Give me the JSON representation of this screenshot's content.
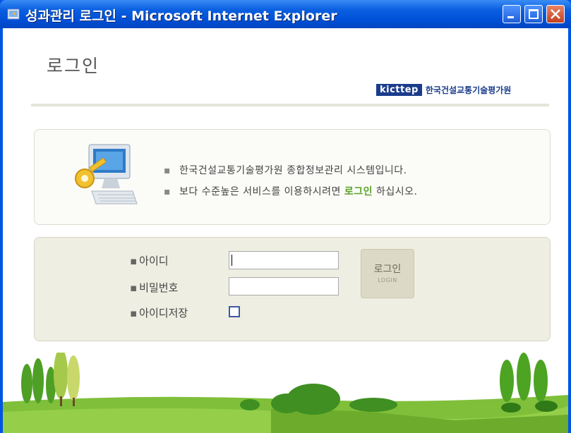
{
  "window": {
    "title": "성과관리 로그인 - Microsoft Internet Explorer",
    "buttons": [
      "minimize-button",
      "maximize-button",
      "close-button"
    ]
  },
  "header": {
    "title": "로그인",
    "logo_mark": "kicttep",
    "logo_name": "한국건설교통기술평가원"
  },
  "info": {
    "line1": "한국건설교통기술평가원 종합정보관리 시스템입니다.",
    "line2_before": "보다 수준높은 서비스를 이용하시려면 ",
    "line2_highlight": "로그인",
    "line2_after": " 하십시오.",
    "bullet": "▪"
  },
  "form": {
    "id_label": "아이디",
    "password_label": "비밀번호",
    "save_id_label": "아이디저장",
    "id_value": "",
    "password_value": "",
    "save_id_checked": false,
    "bullet": "▪"
  },
  "login_button": {
    "label": "로그인",
    "sublabel": "LOGIN"
  },
  "colors": {
    "titlebar": "#0054e3",
    "highlight": "#5aa227",
    "logo": "#1a3c8c",
    "login_panel": "#efeee2"
  }
}
